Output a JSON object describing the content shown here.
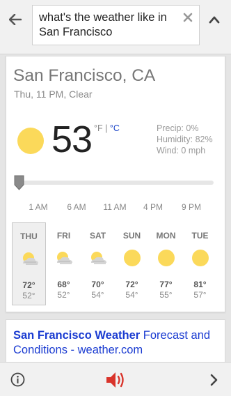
{
  "search": {
    "query": "what's the weather like in San Francisco"
  },
  "weather": {
    "location": "San Francisco, CA",
    "conditions_line": "Thu, 11 PM, Clear",
    "temperature": "53",
    "unit_f": "°F",
    "unit_sep": " | ",
    "unit_c": "°C",
    "precip": "Precip: 0%",
    "humidity": "Humidity: 82%",
    "wind": "Wind: 0 mph",
    "time_labels": [
      "1 AM",
      "6 AM",
      "11 AM",
      "4 PM",
      "9 PM"
    ],
    "slider_position": 0,
    "forecast": [
      {
        "day": "THU",
        "high": "72°",
        "low": "52°",
        "icon": "partly-cloudy-icon",
        "selected": true
      },
      {
        "day": "FRI",
        "high": "68°",
        "low": "52°",
        "icon": "partly-cloudy-icon",
        "selected": false
      },
      {
        "day": "SAT",
        "high": "70°",
        "low": "54°",
        "icon": "partly-cloudy-icon",
        "selected": false
      },
      {
        "day": "SUN",
        "high": "72°",
        "low": "54°",
        "icon": "sunny-icon",
        "selected": false
      },
      {
        "day": "MON",
        "high": "77°",
        "low": "55°",
        "icon": "sunny-icon",
        "selected": false
      },
      {
        "day": "TUE",
        "high": "81°",
        "low": "57°",
        "icon": "sunny-icon",
        "selected": false
      }
    ]
  },
  "result": {
    "title_bold": "San Francisco Weather",
    "title_rest": " Forecast and Conditions - weather.com"
  },
  "colors": {
    "link": "#1a3bd1",
    "sun": "#fbd95a",
    "speaker": "#d9342b"
  }
}
